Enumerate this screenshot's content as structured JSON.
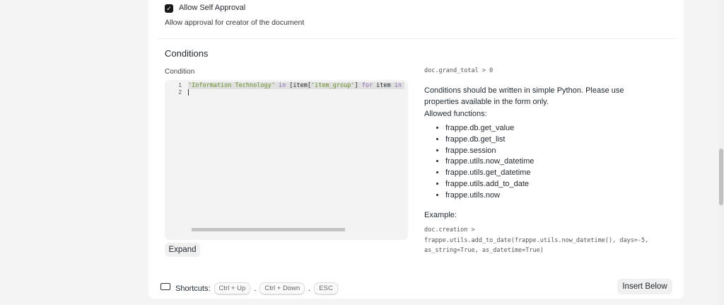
{
  "self_approval": {
    "checked": true,
    "label": "Allow Self Approval",
    "description": "Allow approval for creator of the document"
  },
  "section_title": "Conditions",
  "condition": {
    "label": "Condition",
    "line_numbers": [
      "1",
      "2"
    ],
    "code_tokens": {
      "s1": "'Information Technology'",
      "k1": " in ",
      "p1": "[item[",
      "s2": "'item_group'",
      "p2": "] ",
      "k2": "for",
      "p3": " item ",
      "k3": "in"
    },
    "expand_label": "Expand"
  },
  "help": {
    "placeholder_code": "doc.grand_total > 0",
    "intro": "Conditions should be written in simple Python. Please use properties available in the form only.",
    "allowed_title": "Allowed functions:",
    "functions": [
      "frappe.db.get_value",
      "frappe.db.get_list",
      "frappe.session",
      "frappe.utils.now_datetime",
      "frappe.utils.get_datetime",
      "frappe.utils.add_to_date",
      "frappe.utils.now"
    ],
    "example_title": "Example:",
    "example_lines": [
      "doc.creation >",
      "frappe.utils.add_to_date(frappe.utils.now_datetime(), days=-5,",
      "as_string=True, as_datetime=True)"
    ]
  },
  "footer": {
    "shortcuts_label": "Shortcuts:",
    "keys": [
      "Ctrl + Up",
      "Ctrl + Down",
      "ESC"
    ],
    "sep": ".",
    "insert_below": "Insert Below"
  }
}
